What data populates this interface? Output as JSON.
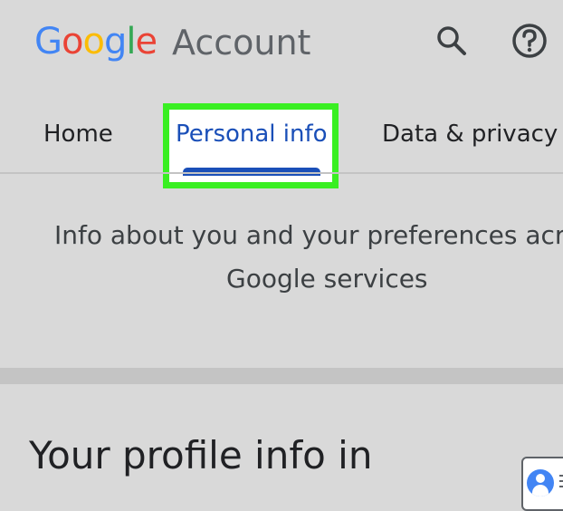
{
  "header": {
    "logo_letters": [
      "G",
      "o",
      "o",
      "g",
      "l",
      "e"
    ],
    "title": "Account",
    "search_icon": "search-icon",
    "help_icon": "help-icon"
  },
  "tabs": [
    {
      "label": "Home"
    },
    {
      "label": "Personal info"
    },
    {
      "label": "Data & privacy"
    }
  ],
  "intro": {
    "line1": "Info about you and your preferences acro",
    "line2": "Google services"
  },
  "profile": {
    "heading": "Your profile info in"
  },
  "colors": {
    "accent": "#1a4fb8",
    "highlight": "#39ef22",
    "google_blue": "#4285f4",
    "google_red": "#ea4335",
    "google_yellow": "#fbbc05",
    "google_green": "#34a853"
  }
}
